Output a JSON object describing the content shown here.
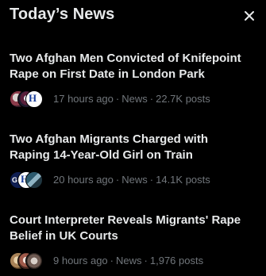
{
  "panel": {
    "title": "Today’s News",
    "close_label": "close"
  },
  "items": [
    {
      "headline": "Two Afghan Men Convicted of Knifepoint Rape on First Date in London Park",
      "time": "17 hours ago",
      "category": "News",
      "posts": "22.7K posts",
      "avatar_badges": [
        "",
        "",
        "H"
      ]
    },
    {
      "headline": "Two Afghan Migrants Charged with Raping 14-Year-Old Girl on Train",
      "time": "20 hours ago",
      "category": "News",
      "posts": "14.1K posts",
      "avatar_badges": [
        "GB",
        "H",
        ""
      ]
    },
    {
      "headline": "Court Interpreter Reveals Migrants' Rape Belief in UK Courts",
      "time": "9 hours ago",
      "category": "News",
      "posts": "1,976 posts",
      "avatar_badges": [
        "",
        "",
        ""
      ]
    }
  ],
  "separator": "·",
  "colors": {
    "background": "#000000",
    "text_primary": "#e7e9ea",
    "text_secondary": "#71767b"
  }
}
